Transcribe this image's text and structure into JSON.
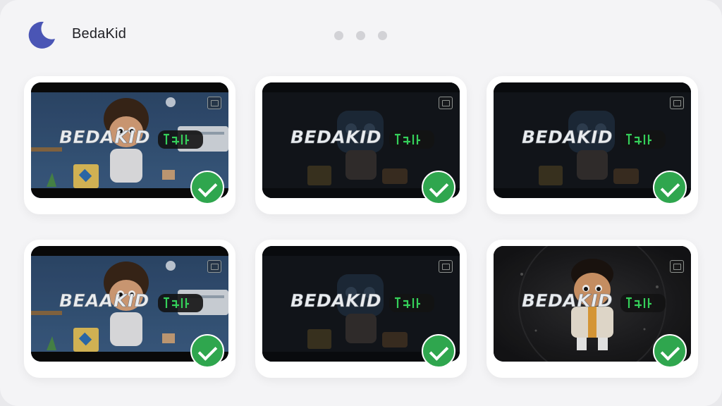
{
  "header": {
    "title": "BedaKid",
    "logo_icon": "crescent-moon-icon",
    "logo_color": "#4a55b5",
    "pager": {
      "pages": 3
    }
  },
  "cards": [
    {
      "logo_text": "BEDAKID",
      "scene": "kid-room-bright",
      "selected": true,
      "badge_icon": "image-icon"
    },
    {
      "logo_text": "BEDAKID",
      "scene": "robot-dark",
      "selected": true,
      "badge_icon": "battery-icon"
    },
    {
      "logo_text": "BEDAKID",
      "scene": "robot-dark",
      "selected": true,
      "badge_icon": "battery-icon"
    },
    {
      "logo_text": "BEAAKID",
      "scene": "kid-room-bright",
      "selected": true,
      "badge_icon": "image-icon"
    },
    {
      "logo_text": "BEDAKID",
      "scene": "robot-dark",
      "selected": true,
      "badge_icon": "battery-icon"
    },
    {
      "logo_text": "BEDAKID",
      "scene": "kid-space",
      "selected": true,
      "badge_icon": "image-icon"
    }
  ],
  "colors": {
    "background": "#f4f4f6",
    "card": "#ffffff",
    "check": "#2fa64e",
    "wordmark_accent": "#35d05a"
  }
}
